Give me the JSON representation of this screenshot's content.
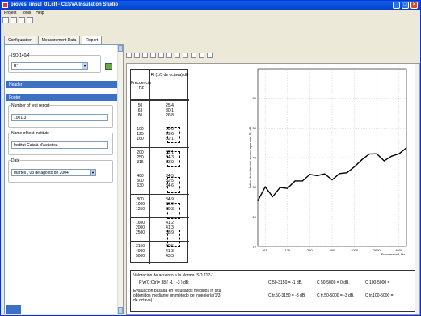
{
  "window": {
    "title": "proves_imsul_01.clf - CESVA Insulation Studio"
  },
  "menu": [
    "Project",
    "Tools",
    "Help"
  ],
  "tabs": [
    "Configuration",
    "Measurement Data",
    "Report"
  ],
  "left": {
    "standard_label": "ISO 140/4",
    "standard_value": "R'",
    "header_label": "Header",
    "footer_label": "Footer",
    "report_number_label": "Number of test report",
    "report_number_value": "1001.3",
    "institute_label": "Name of test institute",
    "institute_value": "Institut Català d'Acústica",
    "date_label": "Date",
    "date_value": "martes , 03 de agosto de 2004"
  },
  "table": {
    "col1": "Frecuencia f Hz",
    "col2": "R' (1/3 de octava) dB",
    "rows": [
      {
        "f": [
          "50",
          "63",
          "80"
        ],
        "r": [
          "25,4",
          "30,1",
          "26,8"
        ]
      },
      {
        "f": [
          "100",
          "125",
          "160"
        ],
        "r": [
          "29,9",
          "29,6",
          "32,1"
        ]
      },
      {
        "f": [
          "200",
          "250",
          "315"
        ],
        "r": [
          "32,1",
          "34,3",
          "33,9"
        ]
      },
      {
        "f": [
          "400",
          "500",
          "630"
        ],
        "r": [
          "34,5",
          "32,5",
          "34,6"
        ]
      },
      {
        "f": [
          "800",
          "1000",
          "1250"
        ],
        "r": [
          "34,9",
          "36,9",
          "39,3"
        ]
      },
      {
        "f": [
          "1600",
          "2000",
          "2500"
        ],
        "r": [
          "41,2",
          "41,3",
          "38,9"
        ]
      },
      {
        "f": [
          "3150",
          "4000",
          "5000"
        ],
        "r": [
          "40,5",
          "41,3",
          "43,3"
        ]
      }
    ]
  },
  "chart_data": {
    "type": "line",
    "ylabel": "Índice de reducción sonora aparente R', dB",
    "xlabel": "Frecuencia f, Hz",
    "x_ticks": [
      "63",
      "125",
      "250",
      "500",
      "1000",
      "2000",
      "4000"
    ],
    "y_ticks": [
      "10",
      "20",
      "30",
      "40",
      "50",
      "60"
    ],
    "ylim": [
      10,
      70
    ],
    "x": [
      "50",
      "63",
      "80",
      "100",
      "125",
      "160",
      "200",
      "250",
      "315",
      "400",
      "500",
      "630",
      "800",
      "1000",
      "1250",
      "1600",
      "2000",
      "2500",
      "3150",
      "4000",
      "5000"
    ],
    "series": [
      {
        "values": [
          25.4,
          30.1,
          26.8,
          29.9,
          29.6,
          32.1,
          32.1,
          34.3,
          33.9,
          34.5,
          32.5,
          34.6,
          34.9,
          36.9,
          39.3,
          41.2,
          41.3,
          38.9,
          40.5,
          41.3,
          43.3
        ]
      }
    ]
  },
  "bottom": {
    "line1": "Valoración de acuerdo a la Norma ISO 717-1",
    "line2": "R'w(C;Ctr)= 38 ( -1 ; -3 ) dB;",
    "line3": "Evaluación basada en resultados medidos in situ obtenidos mediante un método de ingeniería(1/3 de octava)",
    "c1": "C 50-3150 = -1 dB,",
    "c2": "C 50-5000 = 0 dB,",
    "c3": "C 100-5000 =",
    "c4": "C tr,50-3150 = -3 dB,",
    "c5": "C tr,50-5000 = -3 dB,",
    "c6": "C tr,100-5000 ="
  }
}
